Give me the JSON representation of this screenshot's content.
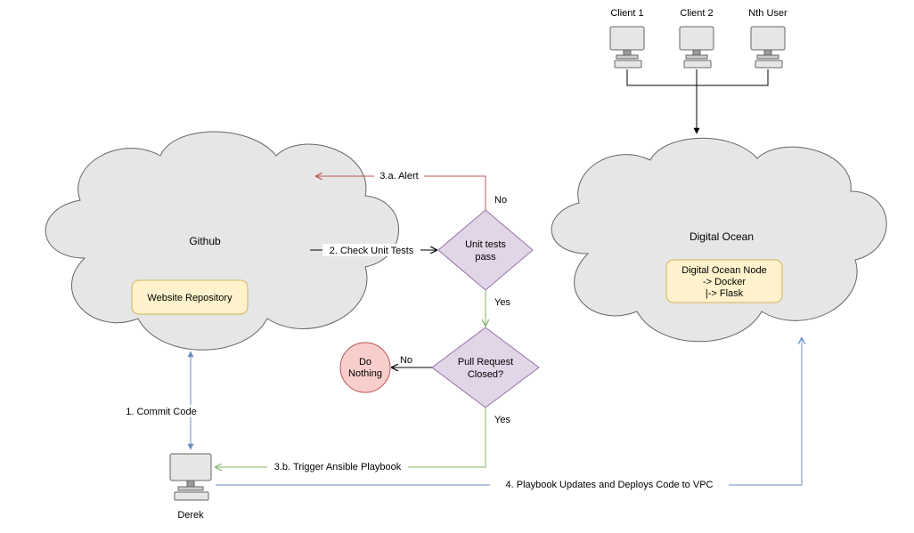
{
  "clients": {
    "c1": "Client 1",
    "c2": "Client 2",
    "cn": "Nth User"
  },
  "clouds": {
    "github": {
      "title": "Github",
      "repo_box": "Website Repository"
    },
    "digitalocean": {
      "title": "Digital Ocean",
      "node_box_line1": "Digital Ocean Node",
      "node_box_line2": "-> Docker",
      "node_box_line3": "|-> Flask"
    }
  },
  "actor": {
    "name": "Derek"
  },
  "decisions": {
    "unit_tests": {
      "label_line1": "Unit tests",
      "label_line2": "pass",
      "yes": "Yes",
      "no": "No"
    },
    "pr_closed": {
      "label_line1": "Pull Request",
      "label_line2": "Closed?",
      "yes": "Yes",
      "no": "No"
    }
  },
  "terminals": {
    "do_nothing_line1": "Do",
    "do_nothing_line2": "Nothing"
  },
  "edges": {
    "commit": "1. Commit Code",
    "check_tests": "2. Check Unit Tests",
    "alert": "3.a. Alert",
    "trigger": "3.b. Trigger Ansible Playbook",
    "deploy": "4. Playbook Updates and Deploys Code to VPC"
  },
  "colors": {
    "cloud_fill": "#dae8fc_placeholder",
    "repo_fill": "#fff2cc",
    "repo_stroke": "#d6b656",
    "decision_fill": "#e1d5e7",
    "decision_stroke": "#9673a6",
    "terminal_fill": "#f8cecc",
    "terminal_stroke": "#b85450",
    "cloud_grey": "#e6e6e6",
    "edge_red": "#b85450",
    "edge_green": "#82b366",
    "edge_blue": "#6c8ebf",
    "edge_black": "#000000"
  }
}
